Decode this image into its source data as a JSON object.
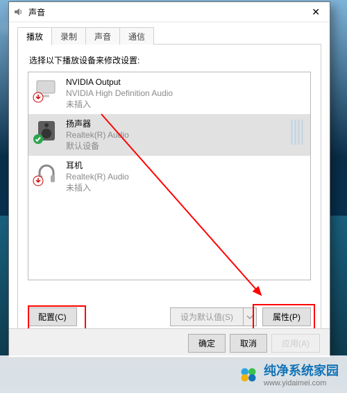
{
  "window": {
    "title": "声音"
  },
  "tabs": [
    "播放",
    "录制",
    "声音",
    "通信"
  ],
  "active_tab": 0,
  "instruction": "选择以下播放设备来修改设置:",
  "devices": [
    {
      "name": "NVIDIA Output",
      "sub": "NVIDIA High Definition Audio",
      "status": "未插入",
      "selected": false,
      "icon": "monitor",
      "badge": "down"
    },
    {
      "name": "扬声器",
      "sub": "Realtek(R) Audio",
      "status": "默认设备",
      "selected": true,
      "icon": "speaker",
      "badge": "check"
    },
    {
      "name": "耳机",
      "sub": "Realtek(R) Audio",
      "status": "未插入",
      "selected": false,
      "icon": "headphone",
      "badge": "down"
    }
  ],
  "buttons": {
    "configure": "配置(C)",
    "set_default": "设为默认值(S)",
    "properties": "属性(P)",
    "ok": "确定",
    "cancel": "取消",
    "apply": "应用(A)"
  },
  "watermark": {
    "brand": "纯净系统家园",
    "url": "www.yidaimei.com"
  }
}
